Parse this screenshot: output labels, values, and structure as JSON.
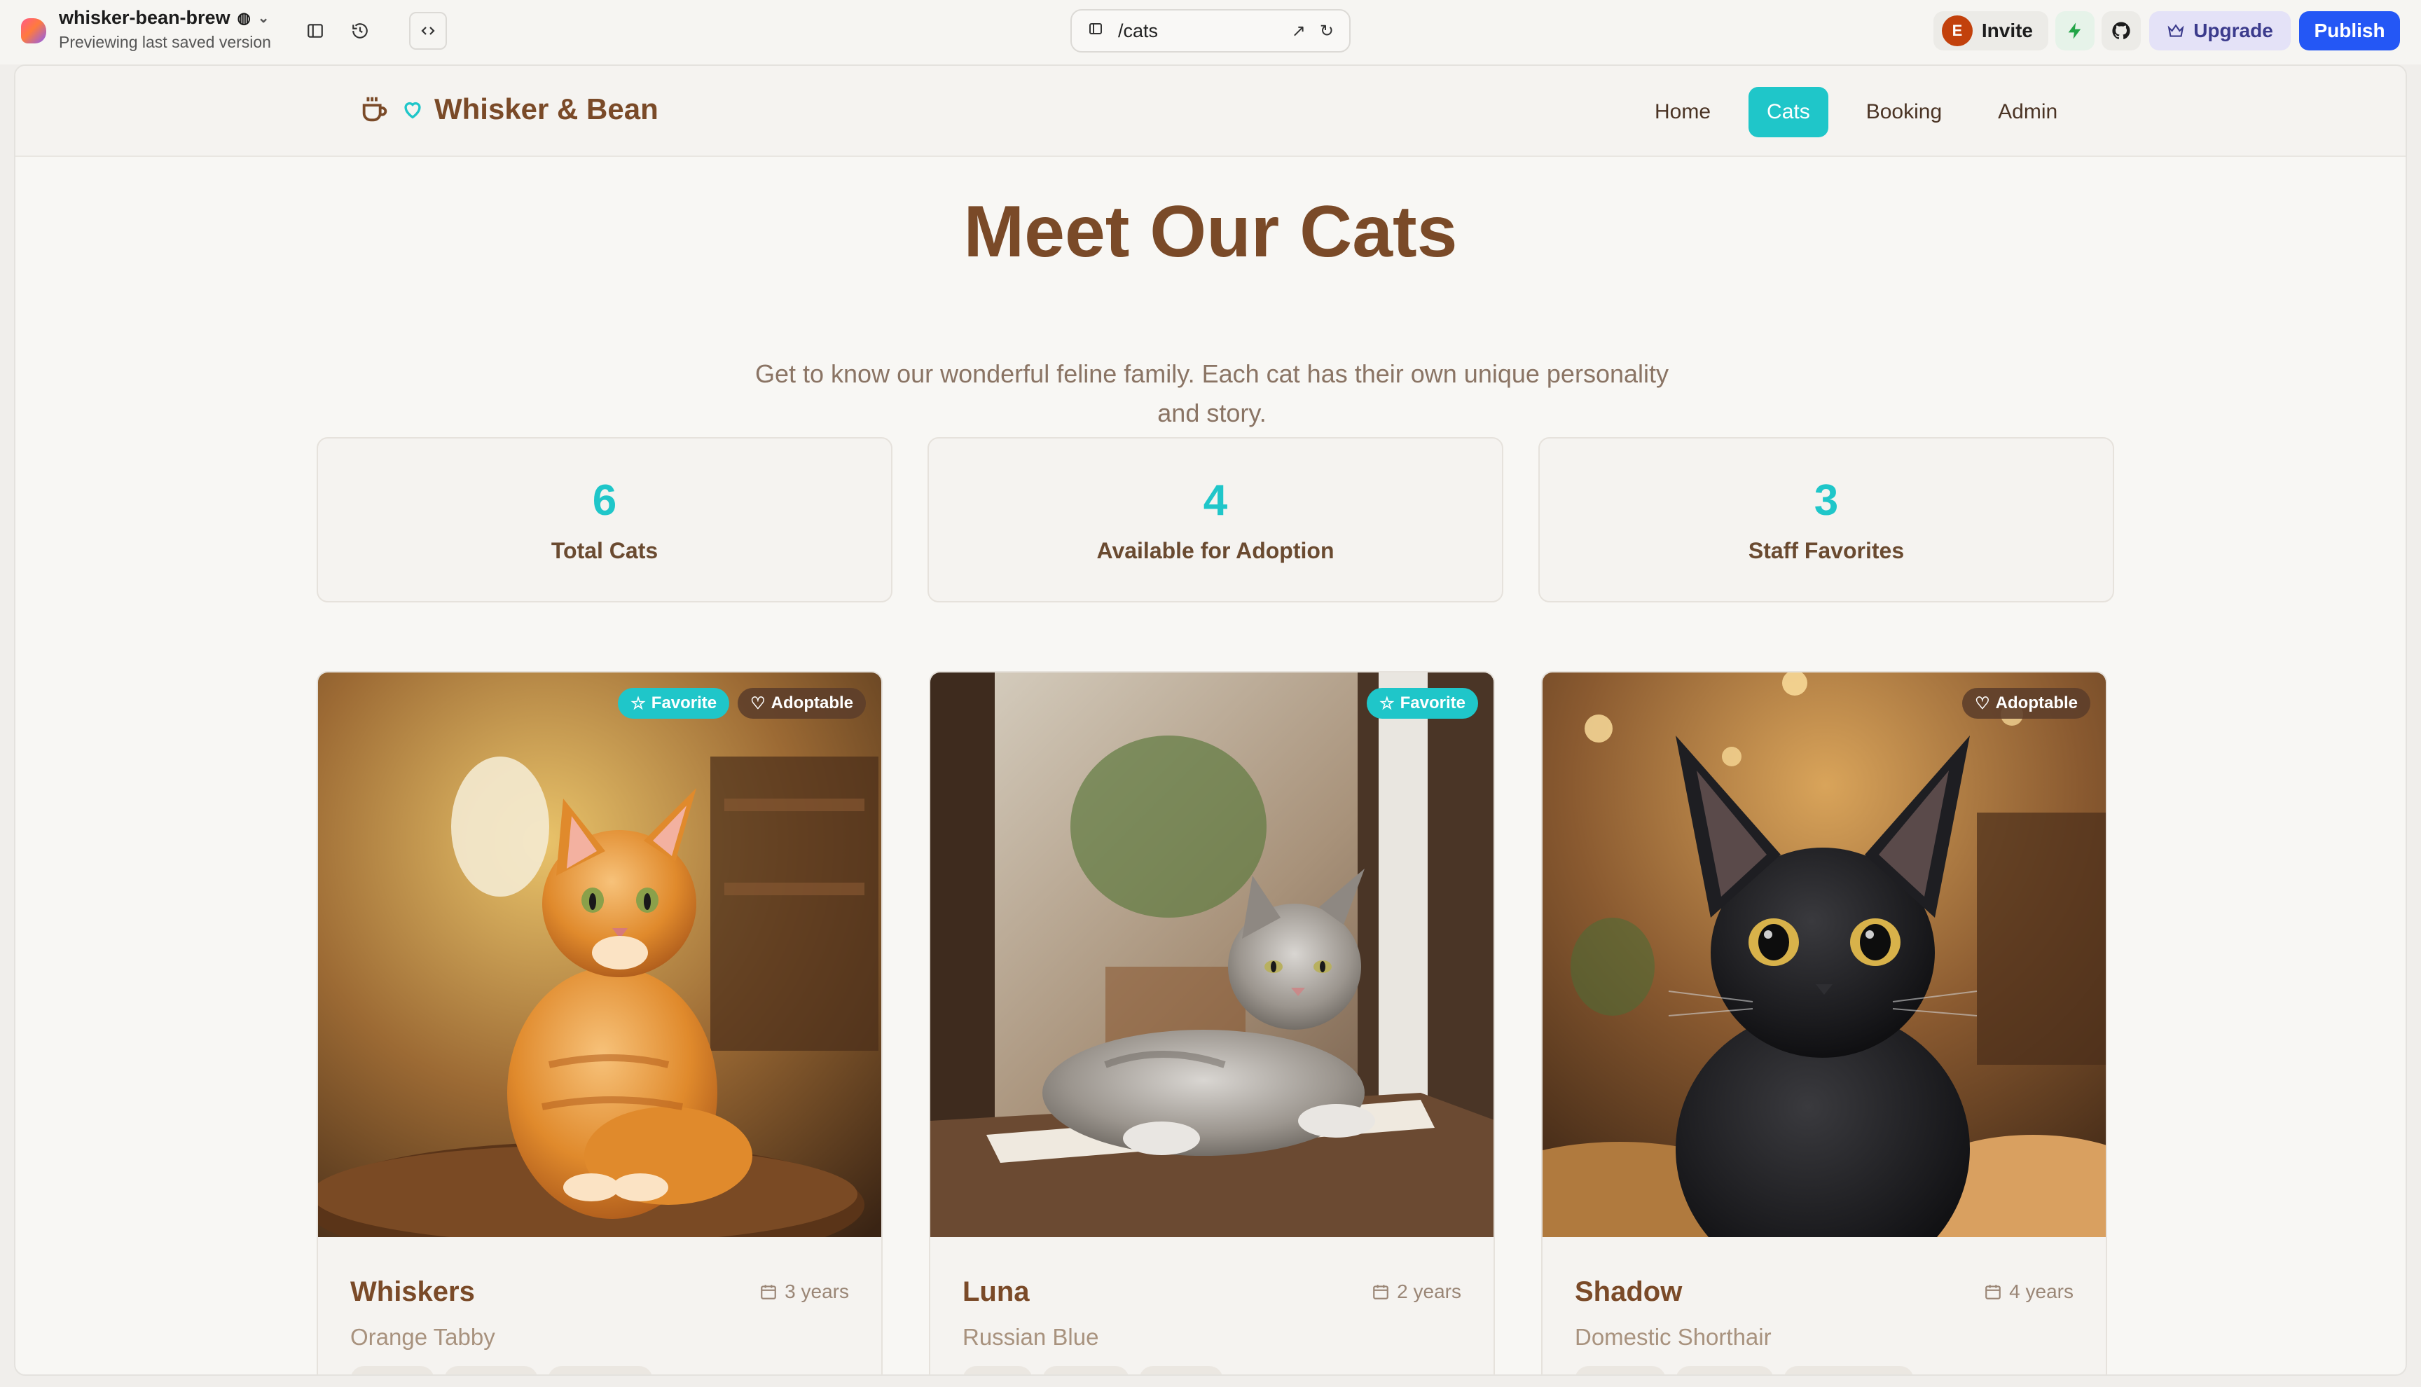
{
  "editor": {
    "project_name": "whisker-bean-brew",
    "project_subtitle": "Previewing last saved version",
    "url_path": "/cats",
    "avatar_initial": "E",
    "invite_label": "Invite",
    "upgrade_label": "Upgrade",
    "publish_label": "Publish"
  },
  "site": {
    "brand_name": "Whisker & Bean",
    "nav": [
      {
        "label": "Home",
        "active": false
      },
      {
        "label": "Cats",
        "active": true
      },
      {
        "label": "Booking",
        "active": false
      },
      {
        "label": "Admin",
        "active": false
      }
    ],
    "hero_title": "Meet Our Cats",
    "hero_subtitle": "Get to know our wonderful feline family. Each cat has their own unique personality and story.",
    "stats": [
      {
        "value": "6",
        "label": "Total Cats"
      },
      {
        "value": "4",
        "label": "Available for Adoption"
      },
      {
        "value": "3",
        "label": "Staff Favorites"
      }
    ],
    "cats": [
      {
        "name": "Whiskers",
        "age": "3 years",
        "breed": "Orange Tabby",
        "badges": [
          "Favorite",
          "Adoptable"
        ]
      },
      {
        "name": "Luna",
        "age": "2 years",
        "breed": "Russian Blue",
        "badges": [
          "Favorite"
        ]
      },
      {
        "name": "Shadow",
        "age": "4 years",
        "breed": "Domestic Shorthair",
        "badges": [
          "Adoptable"
        ]
      }
    ]
  },
  "colors": {
    "accent_teal": "#1fc6c9",
    "brand_brown": "#7a4a28",
    "publish_blue": "#2457f5"
  },
  "icons": {
    "brand": [
      "coffee-cup-icon",
      "heart-icon"
    ],
    "favorite_badge": "star-icon",
    "adoptable_badge": "heart-icon",
    "age": "calendar-icon"
  }
}
